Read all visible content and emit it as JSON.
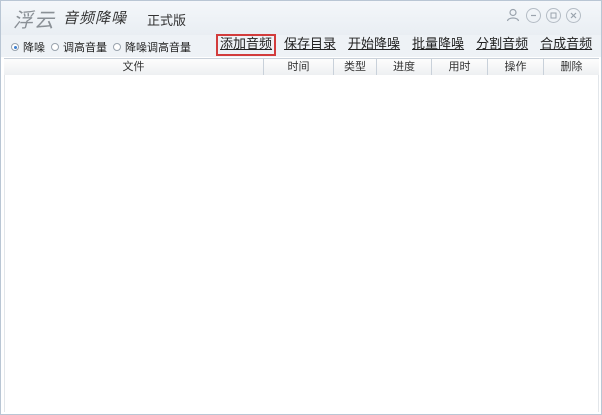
{
  "app": {
    "brand": "浮云",
    "product": "音频降噪",
    "edition": "正式版"
  },
  "title_icons": [
    "user-icon",
    "minimize-icon",
    "maximize-icon",
    "close-icon"
  ],
  "modes": {
    "options": [
      {
        "label": "降噪",
        "selected": true
      },
      {
        "label": "调高音量",
        "selected": false
      },
      {
        "label": "降噪调高音量",
        "selected": false
      }
    ]
  },
  "actions": {
    "add_audio": "添加音频",
    "save_dir": "保存目录",
    "start_denoise": "开始降噪",
    "batch_denoise": "批量降噪",
    "split_audio": "分割音频",
    "merge_audio": "合成音频"
  },
  "table": {
    "columns": [
      "文件",
      "时间",
      "类型",
      "进度",
      "用时",
      "操作",
      "删除"
    ]
  },
  "colors": {
    "highlight_border": "#d23c3c",
    "radio_selected": "#3b7fd0",
    "grid_line": "#c9d1da"
  }
}
